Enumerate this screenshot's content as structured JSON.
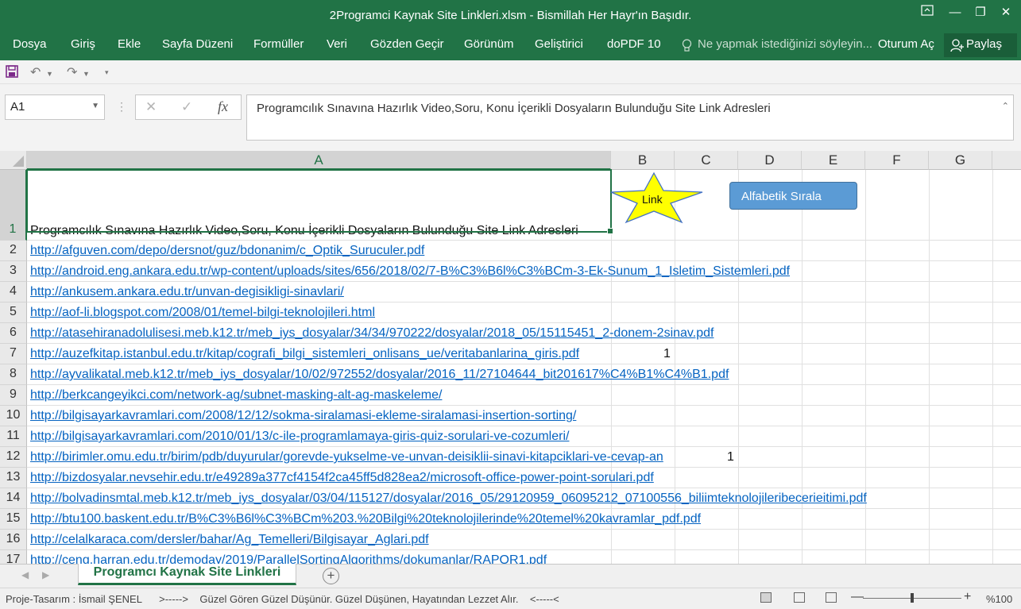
{
  "window": {
    "title": "2Programci Kaynak Site Linkleri.xlsm - Bismillah Her Hayr'ın Başıdır."
  },
  "menu": {
    "tabs": [
      "Dosya",
      "Giriş",
      "Ekle",
      "Sayfa Düzeni",
      "Formüller",
      "Veri",
      "Gözden Geçir",
      "Görünüm",
      "Geliştirici",
      "doPDF 10"
    ],
    "tell_me": "Ne yapmak istediğinizi söyleyin...",
    "sign_in": "Oturum Aç",
    "share": "Paylaş"
  },
  "formula": {
    "name_box": "A1",
    "content": "Programcılık Sınavına Hazırlık Video,Soru, Konu  İçerikli Dosyaların Bulunduğu Site Link Adresleri"
  },
  "columns": [
    "A",
    "B",
    "C",
    "D",
    "E",
    "F",
    "G"
  ],
  "rows": [
    {
      "num": "1",
      "text": "Programcılık Sınavına Hazırlık Video,Soru, Konu  İçerikli Dosyaların Bulunduğu Site Link Adresleri"
    },
    {
      "num": "2",
      "link": "http://afguven.com/depo/dersnot/guz/bdonanim/c_Optik_Suruculer.pdf"
    },
    {
      "num": "3",
      "link": "http://android.eng.ankara.edu.tr/wp-content/uploads/sites/656/2018/02/7-B%C3%B6l%C3%BCm-3-Ek-Sunum_1_Isletim_Sistemleri.pdf"
    },
    {
      "num": "4",
      "link": "http://ankusem.ankara.edu.tr/unvan-degisikligi-sinavlari/"
    },
    {
      "num": "5",
      "link": "http://aof-li.blogspot.com/2008/01/temel-bilgi-teknolojileri.html"
    },
    {
      "num": "6",
      "link": "http://atasehiranadolulisesi.meb.k12.tr/meb_iys_dosyalar/34/34/970222/dosyalar/2018_05/15115451_2-donem-2sinav.pdf"
    },
    {
      "num": "7",
      "link": "http://auzefkitap.istanbul.edu.tr/kitap/cografi_bilgi_sistemleri_onlisans_ue/veritabanlarina_giris.pdf",
      "b": "1"
    },
    {
      "num": "8",
      "link": "http://ayvalikatal.meb.k12.tr/meb_iys_dosyalar/10/02/972552/dosyalar/2016_11/27104644_bit201617%C4%B1%C4%B1.pdf"
    },
    {
      "num": "9",
      "link": "http://berkcangeyikci.com/network-ag/subnet-masking-alt-ag-maskeleme/"
    },
    {
      "num": "10",
      "link": "http://bilgisayarkavramlari.com/2008/12/12/sokma-siralamasi-ekleme-siralamasi-insertion-sorting/"
    },
    {
      "num": "11",
      "link": "http://bilgisayarkavramlari.com/2010/01/13/c-ile-programlamaya-giris-quiz-sorulari-ve-cozumleri/"
    },
    {
      "num": "12",
      "link": "http://birimler.omu.edu.tr/birim/pdb/duyurular/gorevde-yukselme-ve-unvan-deisiklii-sinavi-kitapciklari-ve-cevap-an",
      "c": "1"
    },
    {
      "num": "13",
      "link": "http://bizdosyalar.nevsehir.edu.tr/e49289a377cf4154f2ca45ff5d828ea2/microsoft-office-power-point-sorulari.pdf"
    },
    {
      "num": "14",
      "link": "http://bolvadinsmtal.meb.k12.tr/meb_iys_dosyalar/03/04/115127/dosyalar/2016_05/29120959_06095212_07100556_biliimteknolojileribecerieitimi.pdf"
    },
    {
      "num": "15",
      "link": "http://btu100.baskent.edu.tr/B%C3%B6l%C3%BCm%203.%20Bilgi%20teknolojilerinde%20temel%20kavramlar_pdf.pdf"
    },
    {
      "num": "16",
      "link": "http://celalkaraca.com/dersler/bahar/Ag_Temelleri/Bilgisayar_Aglari.pdf"
    },
    {
      "num": "17",
      "link": "http://ceng.harran.edu.tr/demoday/2019/ParallelSortingAlgorithms/dokumanlar/RAPOR1.pdf"
    }
  ],
  "shapes": {
    "star_label": "Link",
    "sort_button": "Alfabetik Sırala"
  },
  "sheet_tab": "Programcı Kaynak Site Linkleri",
  "status": {
    "text": "Proje-Tasarım : İsmail ŞENEL      >----->    Güzel Gören Güzel Düşünür. Güzel Düşünen, Hayatından Lezzet Alır.    <-----<",
    "zoom": "%100"
  },
  "colors": {
    "excel_green": "#217346",
    "link_blue": "#0563c1",
    "button_blue": "#5b9bd5",
    "star_yellow": "#ffff00"
  }
}
